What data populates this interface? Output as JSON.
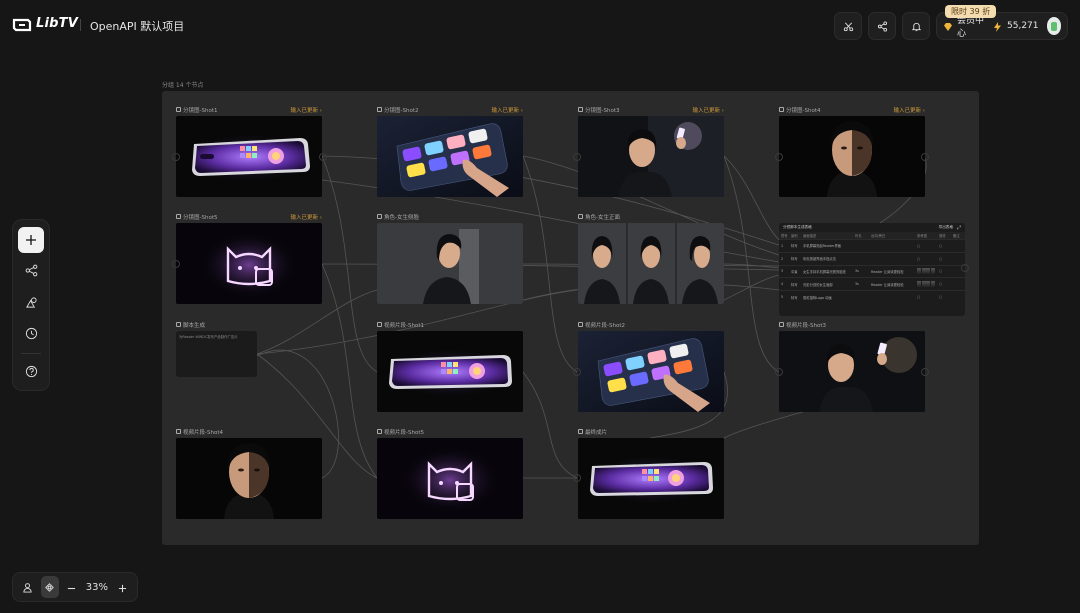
{
  "header": {
    "brand": "LibTV",
    "project_title": "OpenAPI 默认项目",
    "promo_badge": "限时 39 折",
    "member_center": "会员中心",
    "points": "55,271"
  },
  "canvas": {
    "group_label": "分组 14 个节点",
    "zoom_level": "33%"
  },
  "nodes": [
    {
      "title": "分镜图-Shot1",
      "status": "输入已更新 ›",
      "scene": "phone"
    },
    {
      "title": "分镜图-Shot2",
      "status": "输入已更新 ›",
      "scene": "keypad"
    },
    {
      "title": "分镜图-Shot3",
      "status": "输入已更新 ›",
      "scene": "woman-phone"
    },
    {
      "title": "分镜图-Shot4",
      "status": "输入已更新 ›",
      "scene": "face-split"
    },
    {
      "title": "分镜图-Shot5",
      "status": "输入已更新 ›",
      "scene": "neon-cat"
    },
    {
      "title": "角色-女生侧脸",
      "status": "",
      "scene": "woman-profile"
    },
    {
      "title": "角色-女生正面",
      "status": "",
      "scene": "woman-three"
    },
    {
      "title": "视频片段-Shot1",
      "status": "",
      "scene": "phone"
    },
    {
      "title": "视频片段-Shot2",
      "status": "",
      "scene": "keypad"
    },
    {
      "title": "视频片段-Shot3",
      "status": "",
      "scene": "woman-phone"
    },
    {
      "title": "视频片段-Shot4",
      "status": "",
      "scene": "face-split"
    },
    {
      "title": "视频片段-Shot5",
      "status": "",
      "scene": "neon-cat"
    },
    {
      "title": "最终成片",
      "status": "",
      "scene": "phone"
    }
  ],
  "script_node": {
    "title": "脚本生成",
    "body": "为Reader WWDC发布产品制作广告片"
  },
  "table_node": {
    "title": "分镜脚本生成表格",
    "action": "导出表格",
    "columns": [
      "镜号",
      "景别",
      "画面描述",
      "时长",
      "台词/旁白",
      "参考图",
      "音效",
      "备注"
    ],
    "rows": [
      {
        "no": "1",
        "shot": "特写",
        "desc": "手机屏幕亮起Reader界面",
        "dur": "",
        "line": "",
        "has_refs": false
      },
      {
        "no": "2",
        "shot": "特写",
        "desc": "彩色按键界面手指点击",
        "dur": "",
        "line": "",
        "has_refs": false
      },
      {
        "no": "3",
        "shot": "中景",
        "desc": "女生手持手机屏幕光照亮脸庞",
        "dur": "3s",
        "line": "Reader 让阅读更轻松",
        "has_refs": true
      },
      {
        "no": "4",
        "shot": "特写",
        "desc": "光影分割的女生面部",
        "dur": "3s",
        "line": "Reader 让阅读更轻松",
        "has_refs": true
      },
      {
        "no": "5",
        "shot": "特写",
        "desc": "霓虹猫咪Logo 动画",
        "dur": "",
        "line": "",
        "has_refs": false
      }
    ]
  },
  "colors": {
    "canvas_bg": "#161616",
    "group_bg": "#2a2a2a",
    "status_accent": "#d19a3a",
    "promo_bg": "#f3dcb0"
  }
}
